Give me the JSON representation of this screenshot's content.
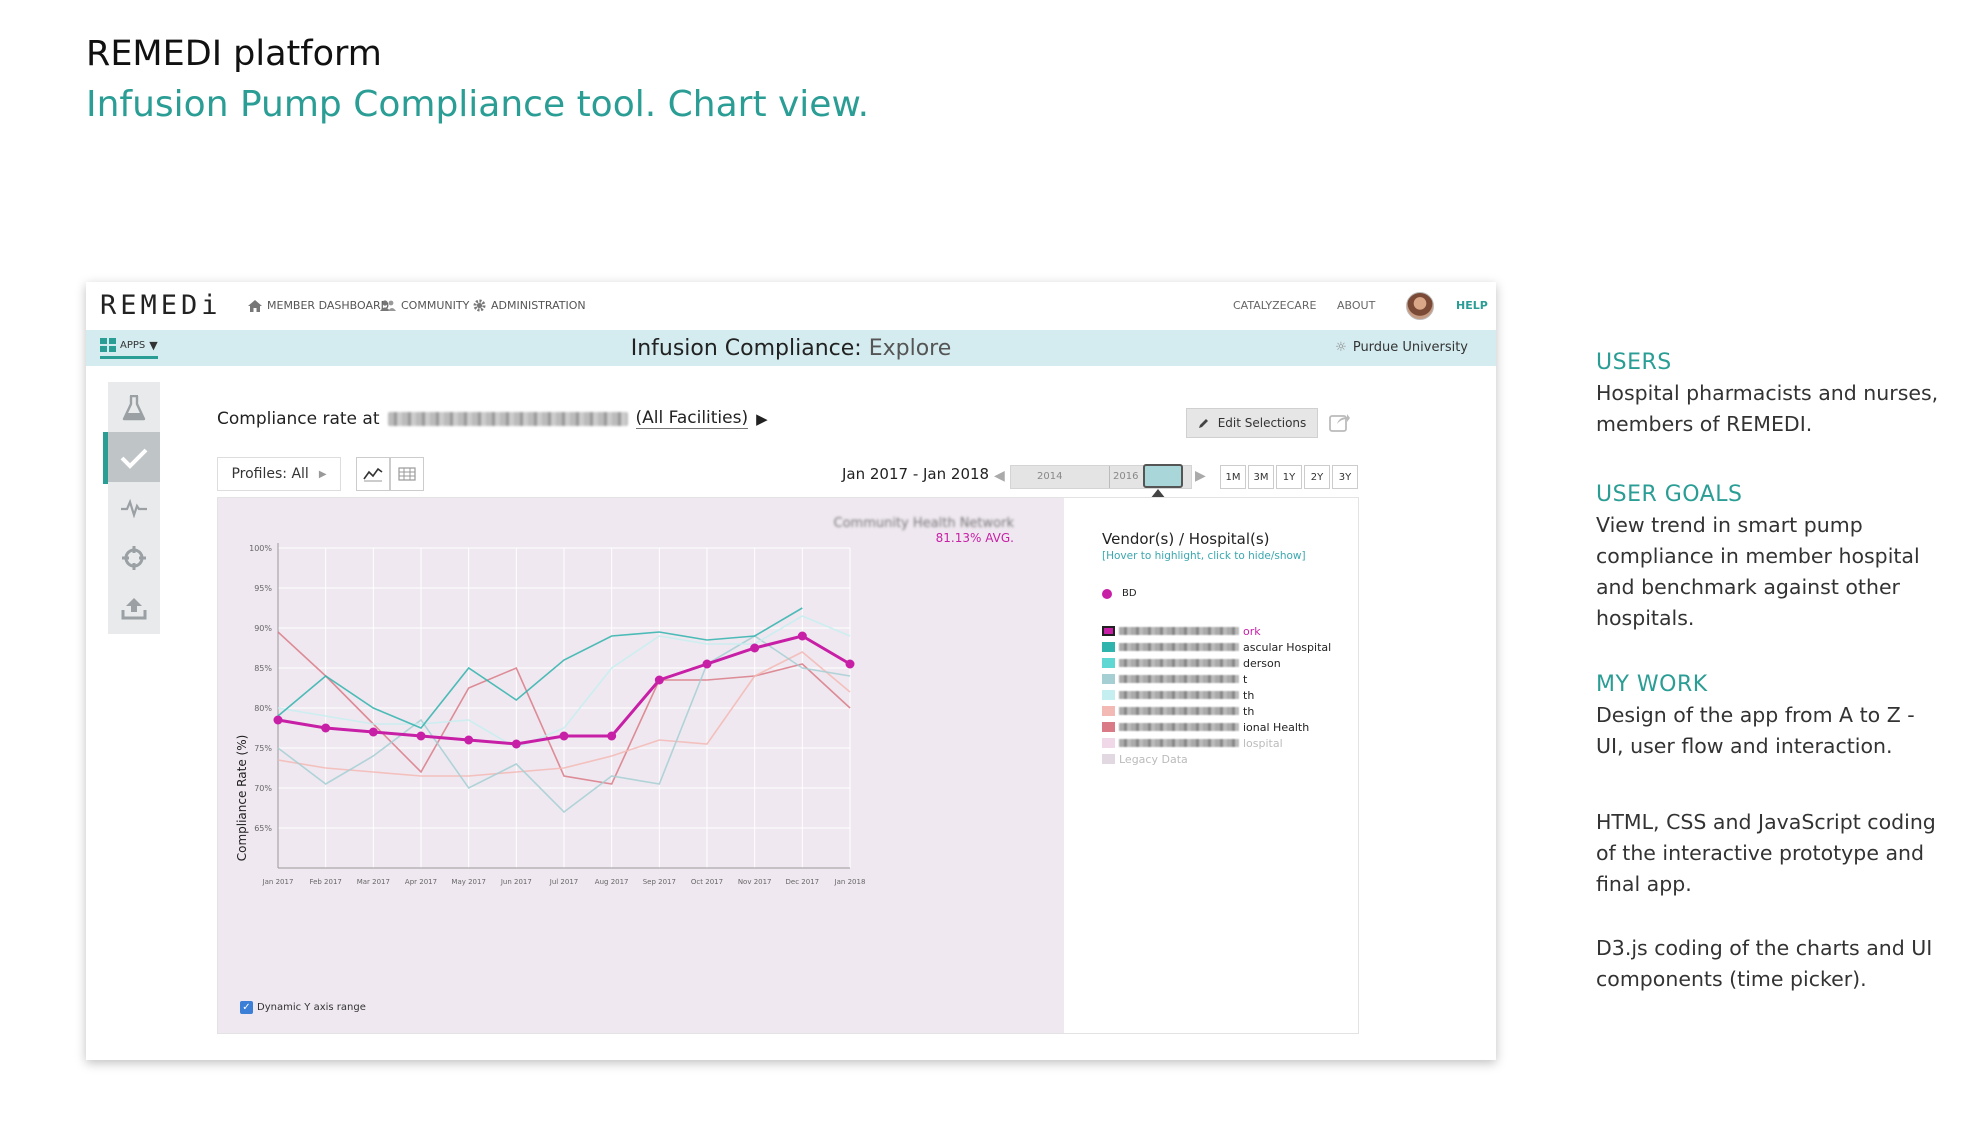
{
  "header": {
    "title": "REMEDI platform",
    "subtitle": "Infusion Pump Compliance tool. Chart view."
  },
  "app": {
    "logo": "REMEDi",
    "nav": {
      "member_dashboard": "MEMBER DASHBOARD",
      "community": "COMMUNITY",
      "administration": "ADMINISTRATION",
      "catalyzecare": "CATALYZECARE",
      "about": "ABOUT",
      "help": "HELP"
    },
    "apps_label": "APPS",
    "page_title_main": "Infusion Compliance:",
    "page_title_sub": "Explore",
    "organization": "Purdue University",
    "compliance_label": "Compliance rate at",
    "compliance_scope": "(All Facilities)",
    "edit_selections": "Edit Selections",
    "profiles": "Profiles: All",
    "date_range": "Jan 2017 - Jan 2018",
    "timeline": {
      "labels": [
        "2014",
        "2016"
      ]
    },
    "range_buttons": [
      "1M",
      "3M",
      "1Y",
      "2Y",
      "3Y"
    ],
    "dynamic_y": "Dynamic Y axis range",
    "legend": {
      "title": "Vendor(s) / Hospital(s)",
      "hint": "[Hover to highlight, click to hide/show]",
      "vendor": "BD",
      "rows": [
        {
          "suffix": "ork",
          "color": "#c71fa6"
        },
        {
          "suffix": "ascular Hospital",
          "color": "#2fb3ad"
        },
        {
          "suffix": "derson",
          "color": "#5fd8d4"
        },
        {
          "suffix": "t",
          "color": "#a5cfd3"
        },
        {
          "suffix": "th",
          "color": "#c5eef0"
        },
        {
          "suffix": "th",
          "color": "#f3b9b4"
        },
        {
          "suffix": "ional Health",
          "color": "#d97a86"
        },
        {
          "suffix": "lospital",
          "color": "#f0d8e8"
        },
        {
          "suffix": "Legacy Data",
          "color": "#e2d8e2"
        }
      ]
    }
  },
  "chart_data": {
    "type": "line",
    "annotation_avg": "81.13% AVG.",
    "ylabel": "Compliance Rate (%)",
    "xlabel": "",
    "ylim": [
      60,
      100
    ],
    "yticks": [
      "65%",
      "70%",
      "75%",
      "80%",
      "85%",
      "90%",
      "95%",
      "100%"
    ],
    "categories": [
      "Jan 2017",
      "Feb 2017",
      "Mar 2017",
      "Apr 2017",
      "May 2017",
      "Jun 2017",
      "Jul 2017",
      "Aug 2017",
      "Sep 2017",
      "Oct 2017",
      "Nov 2017",
      "Dec 2017",
      "Jan 2018"
    ],
    "series": [
      {
        "color": "#d97a86",
        "values": [
          89.5,
          84.0,
          78.0,
          72.0,
          82.5,
          85.0,
          71.5,
          70.5,
          83.5,
          83.5,
          84.0,
          85.5,
          80.0
        ]
      },
      {
        "color": "#f3b9b4",
        "values": [
          73.5,
          72.5,
          72.0,
          71.5,
          71.5,
          72.0,
          72.5,
          74.0,
          76.0,
          75.5,
          84.0,
          87.0,
          82.0
        ]
      },
      {
        "color": "#a5cfd3",
        "values": [
          75.0,
          70.5,
          74.0,
          78.5,
          70.0,
          73.0,
          67.0,
          71.5,
          70.5,
          85.5,
          89.0,
          85.0,
          84.0
        ]
      },
      {
        "color": "#c5eef0",
        "values": [
          80.0,
          79.0,
          78.0,
          78.0,
          78.5,
          75.0,
          77.5,
          85.0,
          89.0,
          88.0,
          88.0,
          91.5,
          89.0
        ]
      },
      {
        "color": "#2fb3ad",
        "values": [
          79.0,
          84.0,
          80.0,
          77.5,
          85.0,
          81.0,
          86.0,
          89.0,
          89.5,
          88.5,
          89.0,
          92.5,
          null
        ]
      },
      {
        "color": "#c71fa6",
        "values": [
          78.5,
          77.5,
          77.0,
          76.5,
          76.0,
          75.5,
          76.5,
          76.5,
          83.5,
          85.5,
          87.5,
          89.0,
          85.5
        ]
      }
    ]
  },
  "aside": {
    "users_head": "USERS",
    "users_body": "Hospital pharmacists and nurses, members of REMEDI.",
    "goals_head": "USER GOALS",
    "goals_body": "View trend in smart pump compliance in member hospital and benchmark against other hospitals.",
    "work_head": "MY WORK",
    "work_body1": "Design of the app from A to Z - UI, user flow and interaction.",
    "work_body2": "HTML, CSS and JavaScript coding of the interactive prototype and final app.",
    "work_body3": "D3.js coding of the charts and UI components (time picker)."
  }
}
